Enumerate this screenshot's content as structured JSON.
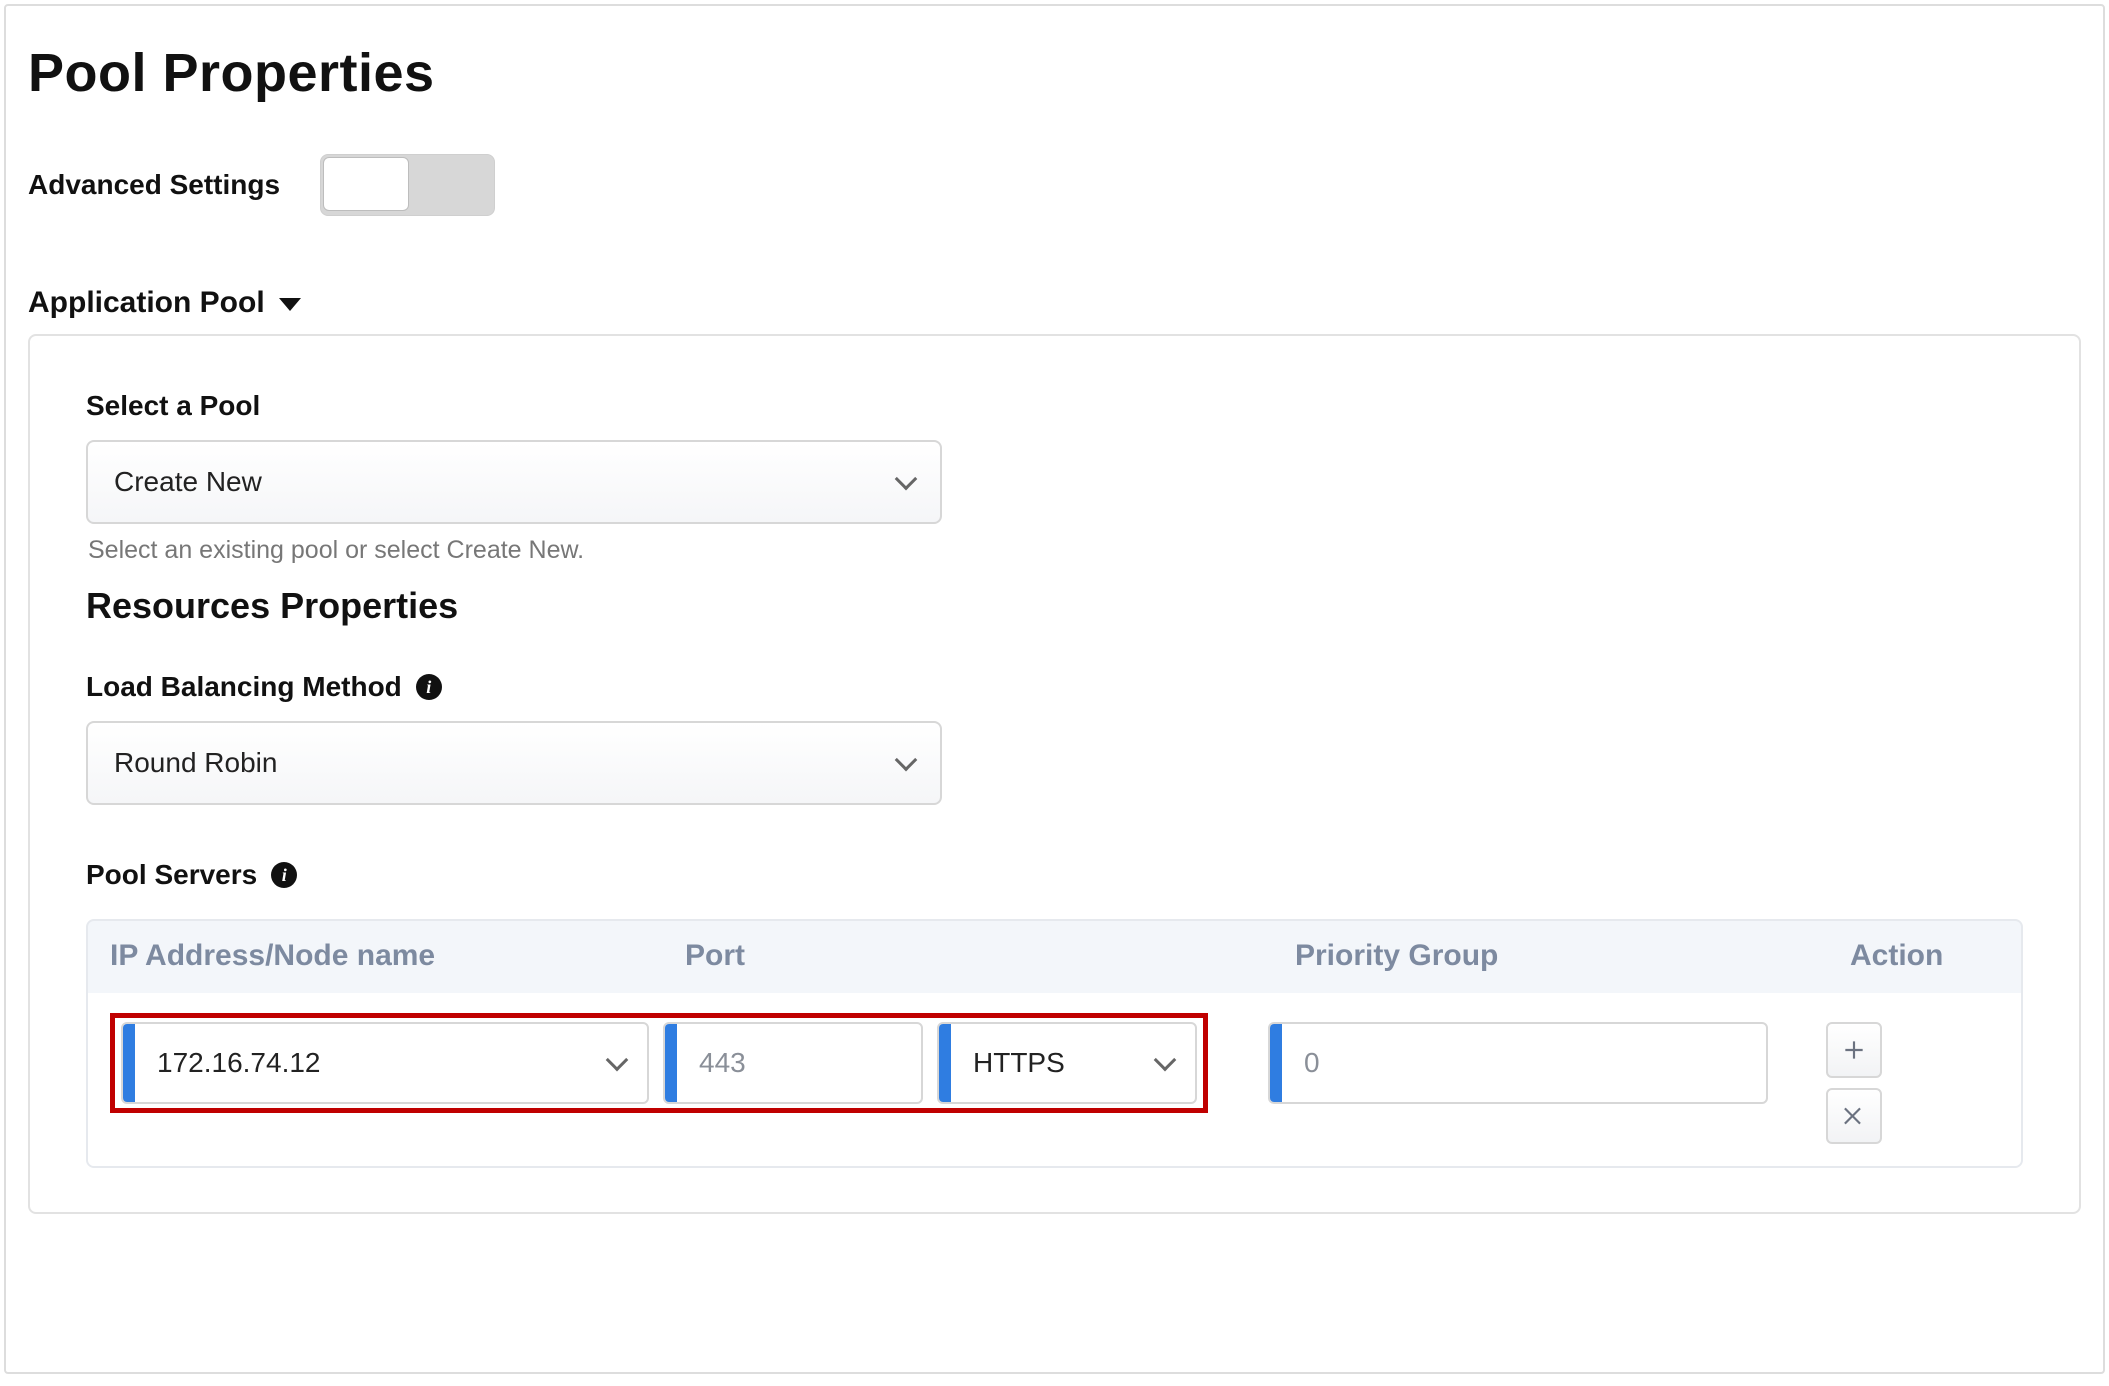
{
  "page": {
    "title": "Pool Properties",
    "advanced_label": "Advanced Settings",
    "section_label": "Application Pool"
  },
  "select_pool": {
    "label": "Select a Pool",
    "value": "Create New",
    "help": "Select an existing pool or select Create New."
  },
  "resources": {
    "title": "Resources Properties",
    "lb_label": "Load Balancing Method",
    "lb_value": "Round Robin",
    "servers_label": "Pool Servers"
  },
  "grid": {
    "headers": {
      "ip": "IP Address/Node name",
      "port": "Port",
      "priority": "Priority Group",
      "action": "Action"
    },
    "row": {
      "ip": "172.16.74.12",
      "port": "443",
      "protocol": "HTTPS",
      "priority": "0"
    }
  }
}
